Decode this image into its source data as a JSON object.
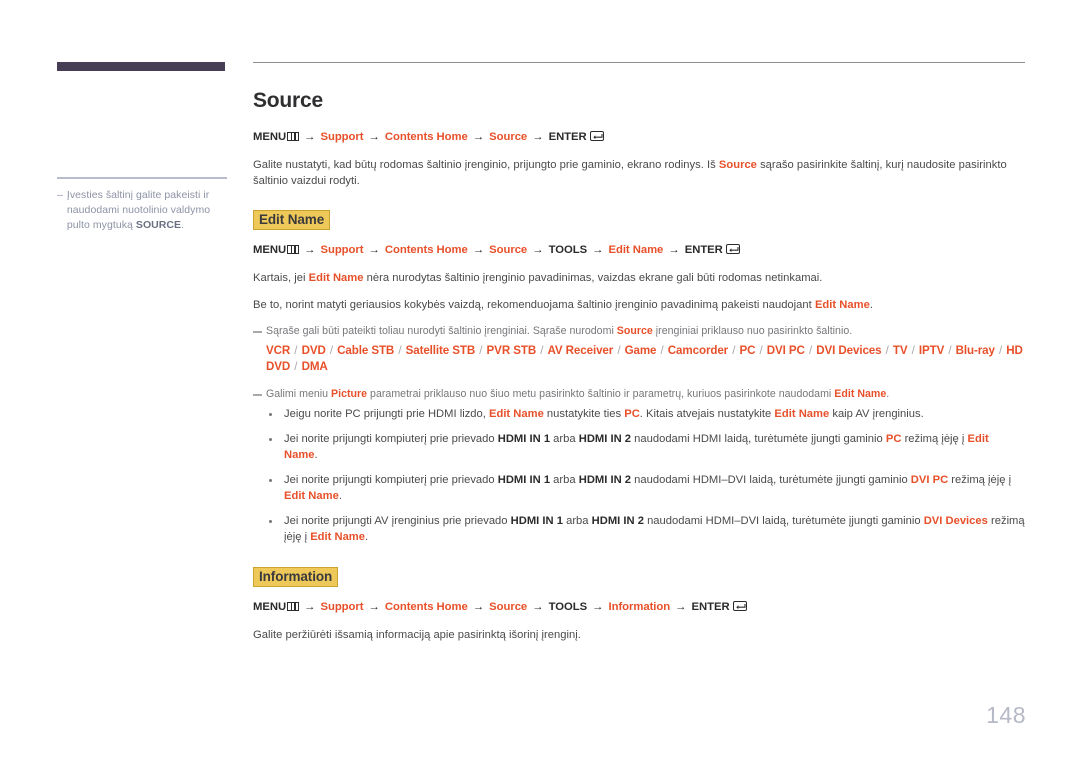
{
  "page": {
    "number": "148"
  },
  "sidebar": {
    "note": {
      "dash": "–",
      "text_before": "Įvesties šaltinį galite pakeisti ir naudodami nuotolinio valdymo pulto mygtuką ",
      "bold": "SOURCE",
      "text_after": "."
    }
  },
  "sections": {
    "source": {
      "title": "Source",
      "path": {
        "menu_label": "MENU",
        "menu_icon": "menu-grid-icon",
        "arrow": "→",
        "steps": [
          "Support",
          "Contents Home",
          "Source"
        ],
        "enter_label": "ENTER",
        "enter_icon": "enter-return-icon"
      },
      "paragraph": {
        "p1": "Galite nustatyti, kad būtų rodomas šaltinio įrenginio, prijungto prie gaminio, ekrano rodinys. Iš ",
        "accent1": "Source",
        "p2": " sąrašo pasirinkite šaltinį, kurį naudosite pasirinkto šaltinio vaizdui rodyti."
      }
    },
    "edit_name": {
      "heading": "Edit Name",
      "path": {
        "menu_label": "MENU",
        "arrow": "→",
        "steps": [
          "Support",
          "Contents Home",
          "Source"
        ],
        "tools_label": "TOOLS",
        "step_last": "Edit Name",
        "enter_label": "ENTER"
      },
      "para1": {
        "a": "Kartais, jei ",
        "accent": "Edit Name",
        "b": " nėra nurodytas šaltinio įrenginio pavadinimas, vaizdas ekrane gali būti rodomas netinkamai."
      },
      "para2": {
        "a": "Be to, norint matyti geriausios kokybės vaizdą, rekomenduojama šaltinio įrenginio pavadinimą pakeisti naudojant ",
        "accent": "Edit Name",
        "b": "."
      },
      "note1": {
        "a": "Sąraše gali būti pateikti toliau nurodyti šaltinio įrenginiai. Sąraše nurodomi ",
        "accent": "Source",
        "b": " įrenginiai priklauso nuo pasirinkto šaltinio."
      },
      "devices": [
        "VCR",
        "DVD",
        "Cable STB",
        "Satellite STB",
        "PVR STB",
        "AV Receiver",
        "Game",
        "Camcorder",
        "PC",
        "DVI PC",
        "DVI Devices",
        "TV",
        "IPTV",
        "Blu-ray",
        "HD DVD",
        "DMA"
      ],
      "device_separator": "/",
      "note2": {
        "a": "Galimi meniu ",
        "accent1": "Picture",
        "b": " parametrai priklauso nuo šiuo metu pasirinkto šaltinio ir parametrų, kuriuos pasirinkote naudodami ",
        "accent2": "Edit Name",
        "c": "."
      },
      "bullets": [
        {
          "parts": [
            {
              "t": "Jeigu norite PC prijungti prie HDMI lizdo, ",
              "s": "n"
            },
            {
              "t": "Edit Name",
              "s": "a"
            },
            {
              "t": " nustatykite ties ",
              "s": "n"
            },
            {
              "t": "PC",
              "s": "a"
            },
            {
              "t": ". Kitais atvejais nustatykite ",
              "s": "n"
            },
            {
              "t": "Edit Name",
              "s": "a"
            },
            {
              "t": " kaip AV įrenginius.",
              "s": "n"
            }
          ]
        },
        {
          "parts": [
            {
              "t": "Jei norite prijungti kompiuterį prie prievado ",
              "s": "n"
            },
            {
              "t": "HDMI IN 1",
              "s": "b"
            },
            {
              "t": " arba ",
              "s": "n"
            },
            {
              "t": "HDMI IN 2",
              "s": "b"
            },
            {
              "t": " naudodami HDMI laidą, turėtumėte įjungti gaminio ",
              "s": "n"
            },
            {
              "t": "PC",
              "s": "a"
            },
            {
              "t": " režimą įėję į ",
              "s": "n"
            },
            {
              "t": "Edit Name",
              "s": "a"
            },
            {
              "t": ".",
              "s": "n"
            }
          ]
        },
        {
          "parts": [
            {
              "t": "Jei norite prijungti kompiuterį prie prievado ",
              "s": "n"
            },
            {
              "t": "HDMI IN 1",
              "s": "b"
            },
            {
              "t": " arba ",
              "s": "n"
            },
            {
              "t": "HDMI IN 2",
              "s": "b"
            },
            {
              "t": " naudodami HDMI–DVI laidą, turėtumėte įjungti gaminio ",
              "s": "n"
            },
            {
              "t": "DVI PC",
              "s": "a"
            },
            {
              "t": " režimą įėję į ",
              "s": "n"
            },
            {
              "t": "Edit Name",
              "s": "a"
            },
            {
              "t": ".",
              "s": "n"
            }
          ]
        },
        {
          "parts": [
            {
              "t": "Jei norite prijungti AV įrenginius prie prievado ",
              "s": "n"
            },
            {
              "t": "HDMI IN 1",
              "s": "b"
            },
            {
              "t": " arba ",
              "s": "n"
            },
            {
              "t": "HDMI IN 2",
              "s": "b"
            },
            {
              "t": " naudodami HDMI–DVI laidą, turėtumėte įjungti gaminio ",
              "s": "n"
            },
            {
              "t": "DVI Devices",
              "s": "a"
            },
            {
              "t": " režimą įėję į ",
              "s": "n"
            },
            {
              "t": "Edit Name",
              "s": "a"
            },
            {
              "t": ".",
              "s": "n"
            }
          ]
        }
      ]
    },
    "information": {
      "heading": "Information",
      "path": {
        "menu_label": "MENU",
        "arrow": "→",
        "steps": [
          "Support",
          "Contents Home",
          "Source"
        ],
        "tools_label": "TOOLS",
        "step_last": "Information",
        "enter_label": "ENTER"
      },
      "paragraph": "Galite peržiūrėti išsamią informaciją apie pasirinktą išorinį įrenginį."
    }
  },
  "colors": {
    "accent": "#e8502a",
    "highlight_bg": "#eec959",
    "highlight_border": "#c8a42f",
    "rail_bar": "#463e54",
    "page_number": "#b6b9c6"
  }
}
